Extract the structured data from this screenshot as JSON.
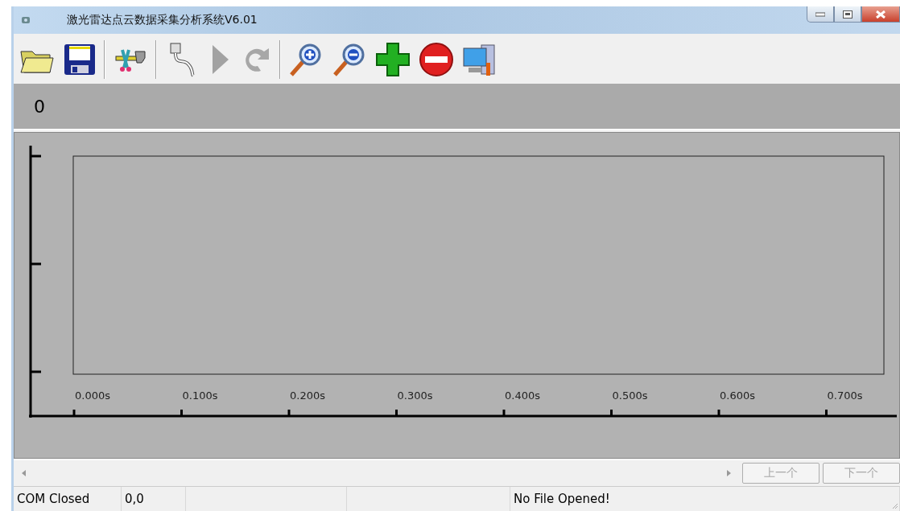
{
  "window": {
    "title": "激光雷达点云数据采集分析系统V6.01"
  },
  "toolbar": {
    "groups": [
      [
        {
          "kind": "folder",
          "disabled": false
        },
        {
          "kind": "floppy",
          "disabled": false
        }
      ],
      [
        {
          "kind": "tools",
          "disabled": false
        }
      ],
      [
        {
          "kind": "cable",
          "disabled": false
        },
        {
          "kind": "play",
          "disabled": true
        },
        {
          "kind": "redo",
          "disabled": true
        }
      ],
      [
        {
          "kind": "zoomin",
          "disabled": false
        },
        {
          "kind": "zoomout",
          "disabled": false
        },
        {
          "kind": "plus",
          "disabled": false
        },
        {
          "kind": "minus",
          "disabled": false
        },
        {
          "kind": "computer",
          "disabled": false
        }
      ]
    ]
  },
  "readout": "0",
  "chart": {
    "x_tick_labels": [
      "0.000s",
      "0.100s",
      "0.200s",
      "0.300s",
      "0.400s",
      "0.500s",
      "0.600s",
      "0.700s"
    ]
  },
  "nav_buttons": [
    {
      "label": "上一个",
      "disabled": true
    },
    {
      "label": "下一个",
      "disabled": true
    }
  ],
  "status_bar": {
    "cells": [
      "COM Closed",
      "0,0",
      "",
      "",
      "No File Opened!"
    ]
  }
}
